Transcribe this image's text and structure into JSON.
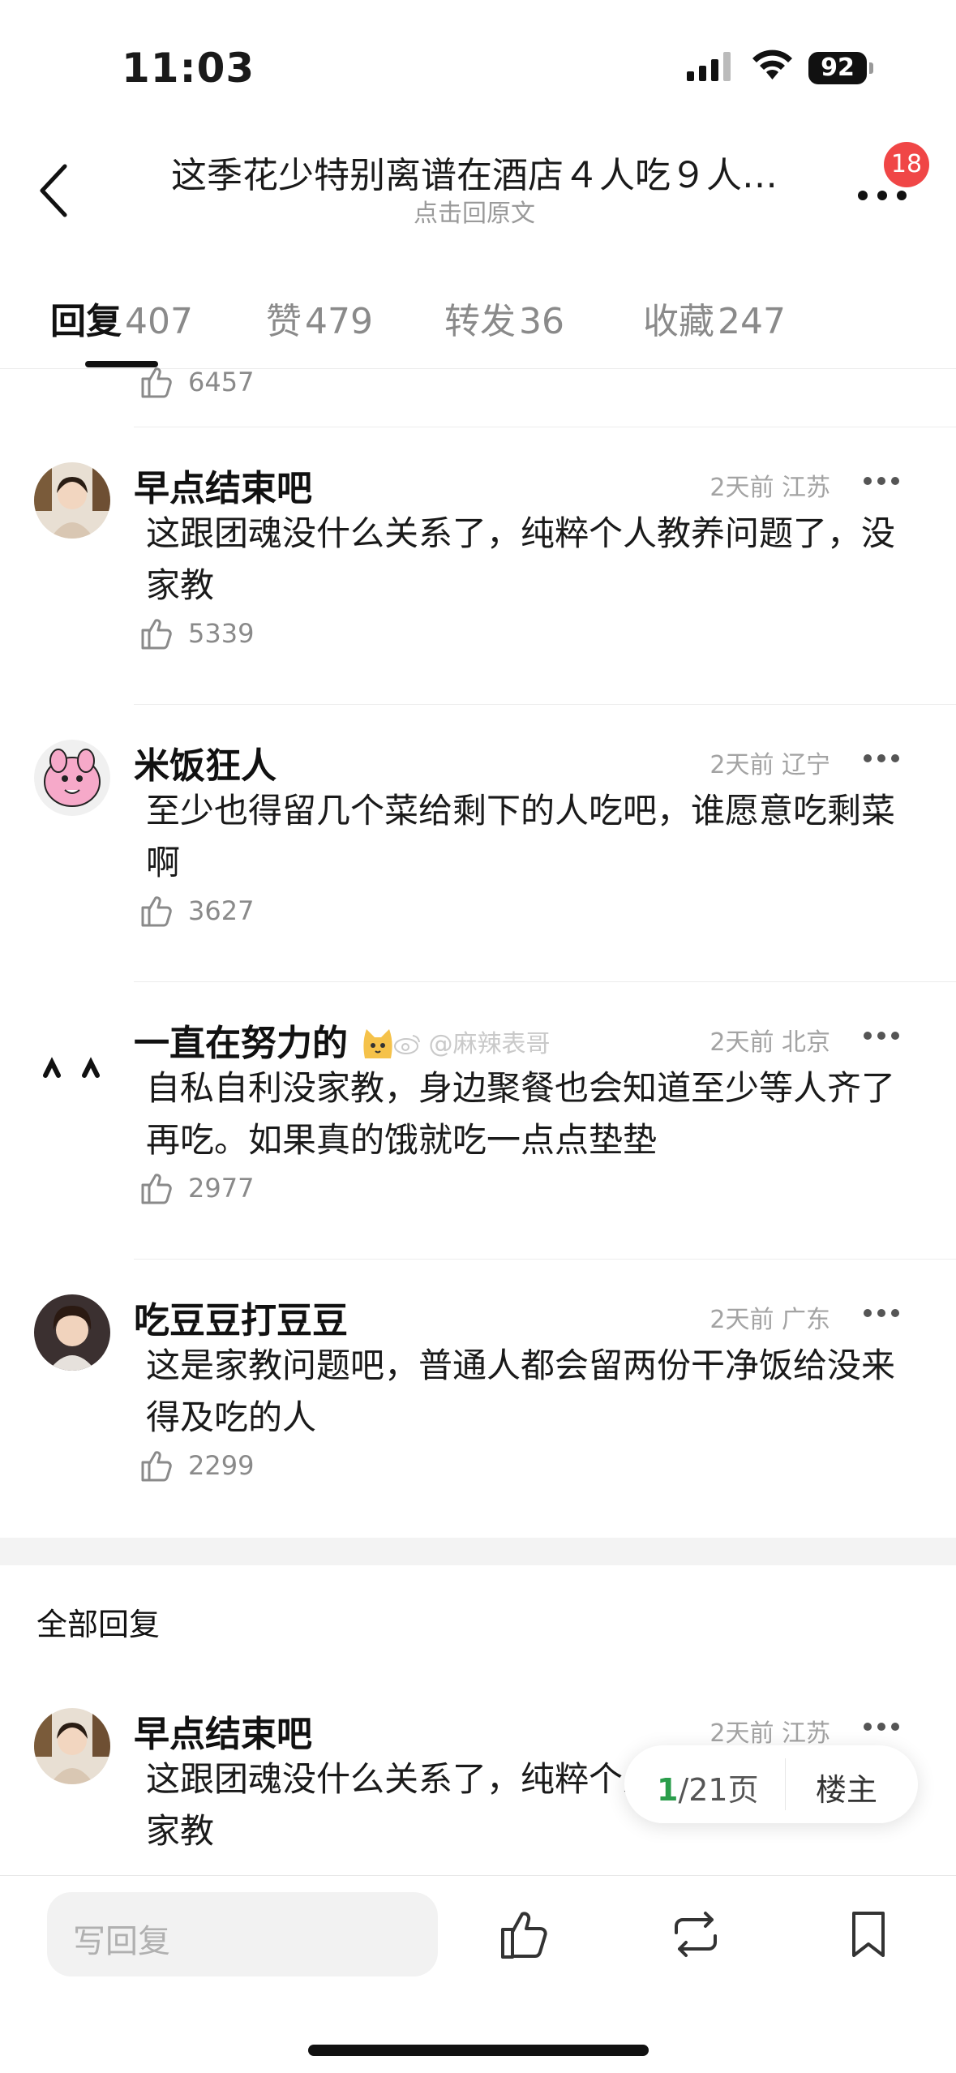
{
  "status_bar": {
    "time": "11:03",
    "battery": "92"
  },
  "header": {
    "title": "这季花少特别离谱在酒店４人吃９人…",
    "subtitle": "点击回原文",
    "badge": "18"
  },
  "tabs": [
    {
      "label": "回复",
      "count": "407",
      "active": true
    },
    {
      "label": "赞",
      "count": "479"
    },
    {
      "label": "转发",
      "count": "36"
    },
    {
      "label": "收藏",
      "count": "247"
    }
  ],
  "top_partial_like": "6457",
  "comments": [
    {
      "username": "早点结束吧",
      "time": "2天前",
      "location": "江苏",
      "text": "这跟团魂没什么关系了，纯粹个人教养问题了，没家教",
      "likes": "5339"
    },
    {
      "username": "米饭狂人",
      "time": "2天前",
      "location": "辽宁",
      "text": "至少也得留几个菜给剩下的人吃吧，谁愿意吃剩菜啊",
      "likes": "3627"
    },
    {
      "username": "一直在努力的",
      "time": "2天前",
      "location": "北京",
      "text": "自私自利没家教，身边聚餐也会知道至少等人齐了再吃。如果真的饿就吃一点点垫垫",
      "likes": "2977"
    },
    {
      "username": "吃豆豆打豆豆",
      "time": "2天前",
      "location": "广东",
      "text": "这是家教问题吧，普通人都会留两份干净饭给没来得及吃的人",
      "likes": "2299"
    }
  ],
  "watermark": "@麻辣表哥",
  "all_replies_title": "全部回复",
  "bottom_comment": {
    "username": "早点结束吧",
    "time": "2天前",
    "location": "江苏",
    "text": "这跟团魂没什么关系了，纯粹个人教养问题了，没家教"
  },
  "pager": {
    "current": "1",
    "total_text": "/21页",
    "op_label": "楼主"
  },
  "bottom_bar": {
    "reply_placeholder": "写回复"
  }
}
